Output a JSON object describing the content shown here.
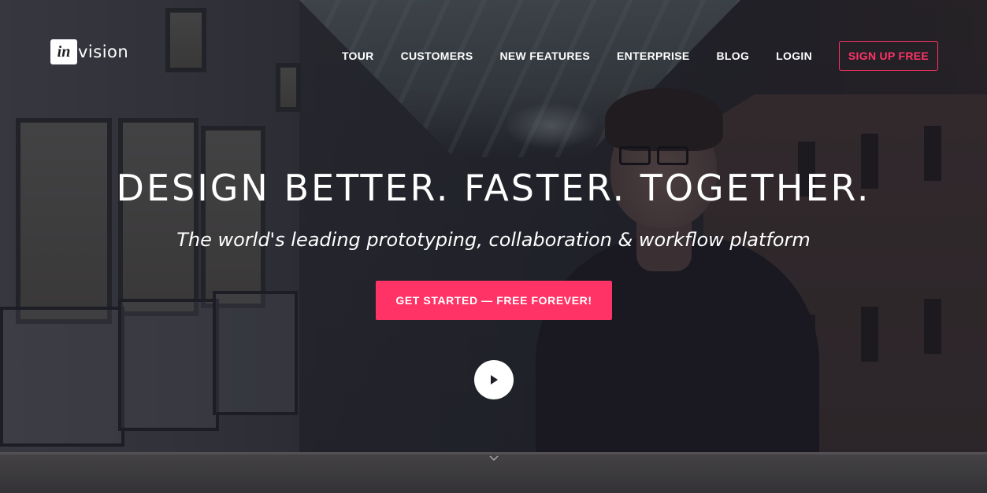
{
  "brand": {
    "logo_mark": "in",
    "logo_text": "vision",
    "accent_color": "#ff3366"
  },
  "nav": {
    "items": [
      {
        "label": "TOUR"
      },
      {
        "label": "CUSTOMERS"
      },
      {
        "label": "NEW FEATURES"
      },
      {
        "label": "ENTERPRISE"
      },
      {
        "label": "BLOG"
      },
      {
        "label": "LOGIN"
      }
    ],
    "signup_label": "SIGN UP FREE"
  },
  "hero": {
    "headline": "DESIGN BETTER. FASTER. TOGETHER.",
    "subheadline": "The world's leading prototyping, collaboration & workflow platform",
    "cta_label": "GET STARTED — FREE FOREVER!",
    "play_icon": "play-icon",
    "scroll_icon": "chevron-down-icon"
  }
}
